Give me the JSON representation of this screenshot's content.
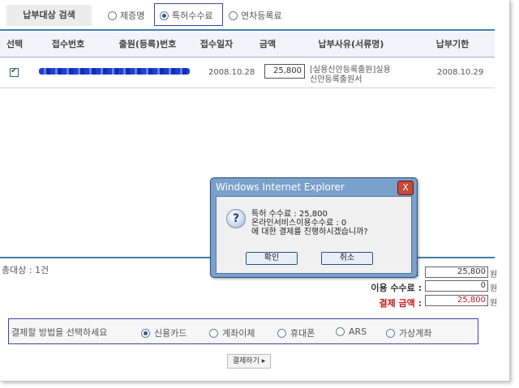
{
  "search": {
    "label": "납부대상 검색",
    "options": [
      {
        "label": "제증명",
        "selected": false
      },
      {
        "label": "특허수수료",
        "selected": true
      },
      {
        "label": "연차등록료",
        "selected": false
      }
    ]
  },
  "table": {
    "headers": [
      "선택",
      "접수번호",
      "출원(등록)번호",
      "접수일자",
      "금액",
      "납부사유(서류명)",
      "납부기한"
    ],
    "rows": [
      {
        "checked": true,
        "receipt_date": "2008.10.28",
        "amount": "25,800",
        "reason_line1": "[실용신안등록출원]실용",
        "reason_line2": "신안등록출원서",
        "due_date": "2008.10.29"
      }
    ]
  },
  "summary": {
    "count_text": "총대상 : 1건",
    "fee_total_label": ":",
    "fee_total_value": "25,800",
    "usage_fee_label": "이용 수수료 :",
    "usage_fee_value": "0",
    "payment_amount_label": "결제 금액 :",
    "payment_amount_value": "25,800",
    "currency": "원"
  },
  "payment": {
    "label": "결제할 방법을 선택하세요",
    "options": [
      {
        "label": "신용카드",
        "selected": true
      },
      {
        "label": "계좌이체",
        "selected": false
      },
      {
        "label": "휴대폰",
        "selected": false
      },
      {
        "label": "ARS",
        "selected": false
      },
      {
        "label": "가상계좌",
        "selected": false
      }
    ],
    "button_label": "결제하기 ▸"
  },
  "dialog": {
    "title": "Windows Internet Explorer",
    "close": "X",
    "line1": "특허 수수료 : 25,800",
    "line2": "온라인서비스이용수수료 : 0",
    "line3": "에 대한 결제를 진행하시겠습니까?",
    "ok": "확인",
    "cancel": "취소"
  }
}
